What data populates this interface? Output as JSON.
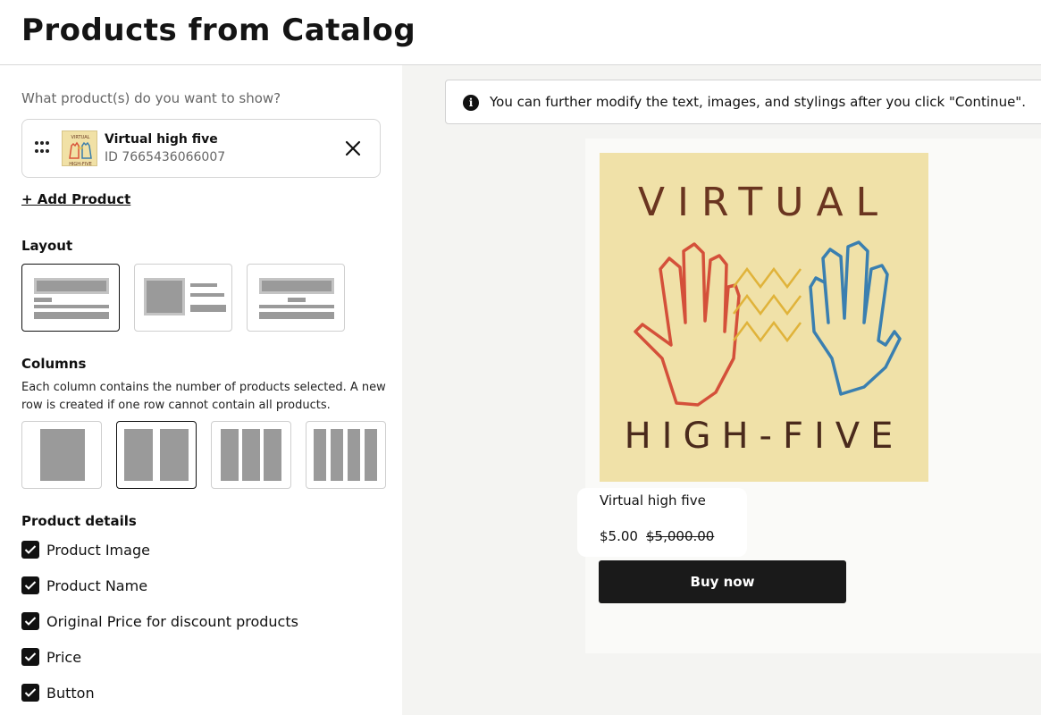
{
  "header": {
    "title": "Products from Catalog"
  },
  "left": {
    "question": "What product(s) do you want to show?",
    "selected_product": {
      "name": "Virtual high five",
      "id": "ID 7665436066007"
    },
    "add_product": "+ Add Product",
    "layout": {
      "label": "Layout",
      "selected_index": 0
    },
    "columns": {
      "label": "Columns",
      "description": "Each column contains the number of products selected. A new row is created if one row cannot contain all products.",
      "selected_index": 1
    },
    "product_details": {
      "label": "Product details",
      "options": [
        {
          "label": "Product Image",
          "checked": true
        },
        {
          "label": "Product Name",
          "checked": true
        },
        {
          "label": "Original Price for discount products",
          "checked": true
        },
        {
          "label": "Price",
          "checked": true
        },
        {
          "label": "Button",
          "checked": true
        }
      ]
    }
  },
  "preview": {
    "info_text": "You can further modify the text, images, and stylings after you click \"Continue\".",
    "image_text_top": "VIRTUAL",
    "image_text_bottom": "HIGH-FIVE",
    "product_name": "Virtual high five",
    "price": "$5.00",
    "original_price": "$5,000.00",
    "button_label": "Buy now"
  },
  "icons": [
    "drag-handle-icon",
    "close-icon",
    "info-icon",
    "checkbox-checked-icon"
  ]
}
